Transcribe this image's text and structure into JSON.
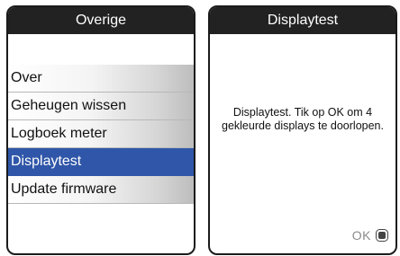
{
  "left_screen": {
    "title": "Overige",
    "menu": [
      {
        "label": "Over",
        "selected": false
      },
      {
        "label": "Geheugen wissen",
        "selected": false
      },
      {
        "label": "Logboek meter",
        "selected": false
      },
      {
        "label": "Displaytest",
        "selected": true
      },
      {
        "label": "Update firmware",
        "selected": false
      }
    ]
  },
  "right_screen": {
    "title": "Displaytest",
    "message": "Displaytest. Tik op OK om 4 gekleurde displays te doorlopen.",
    "ok_label": "OK",
    "ok_icon": "stop-square-icon"
  },
  "colors": {
    "title_bar": "#222222",
    "selected": "#2f56a8"
  }
}
